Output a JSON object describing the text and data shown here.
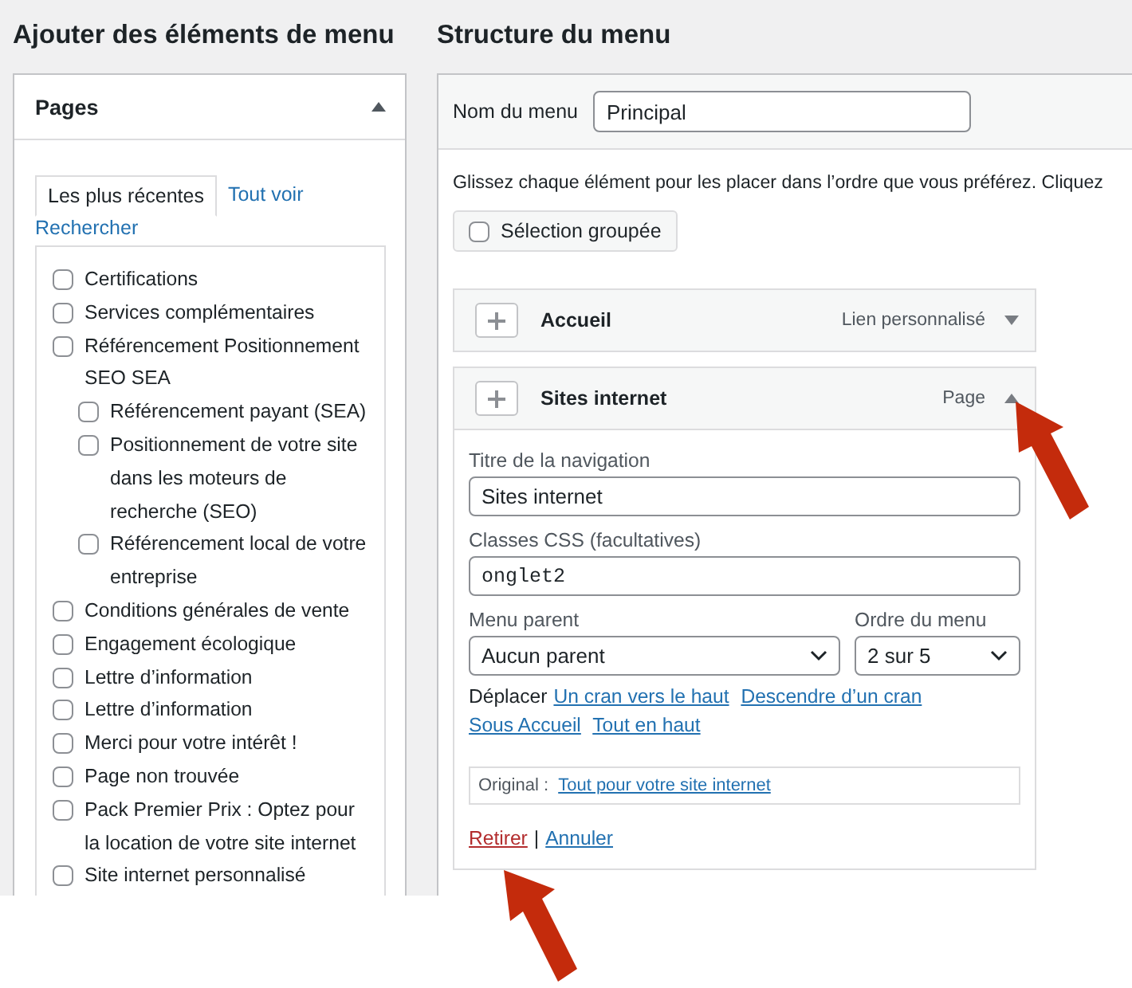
{
  "left": {
    "title": "Ajouter des éléments de menu",
    "panel": {
      "title": "Pages",
      "expanded": true,
      "tabs": [
        {
          "label": "Les plus récentes",
          "selected": true
        },
        {
          "label": "Tout voir",
          "selected": false
        },
        {
          "label": "Rechercher",
          "selected": false
        }
      ],
      "pages": [
        {
          "label": "Certifications",
          "checked": false
        },
        {
          "label": "Services complémentaires",
          "checked": false
        },
        {
          "label": "Référencement Positionnement SEO SEA",
          "checked": false,
          "children": [
            {
              "label": "Référencement payant (SEA)",
              "checked": false
            },
            {
              "label": "Positionnement de votre site dans les moteurs de recherche (SEO)",
              "checked": false
            },
            {
              "label": "Référencement local de votre entreprise",
              "checked": false
            }
          ]
        },
        {
          "label": "Conditions générales de vente",
          "checked": false
        },
        {
          "label": "Engagement écologique",
          "checked": false
        },
        {
          "label": "Lettre d’information",
          "checked": false
        },
        {
          "label": "Lettre d’information",
          "checked": false
        },
        {
          "label": "Merci pour votre intérêt !",
          "checked": false
        },
        {
          "label": "Page non trouvée",
          "checked": false
        },
        {
          "label": "Pack Premier Prix : Optez pour la location de votre site internet",
          "checked": false
        },
        {
          "label": "Site internet personnalisé",
          "checked": false
        }
      ]
    }
  },
  "right": {
    "title": "Structure du menu",
    "menu_name_label": "Nom du menu",
    "menu_name": "Principal",
    "instructions": "Glissez chaque élément pour les placer dans l’ordre que vous préférez. Cliquez",
    "bulk_select": {
      "label": "Sélection groupée",
      "checked": false
    },
    "menu_items": [
      {
        "title": "Accueil",
        "type": "Lien personnalisé",
        "expanded": false
      },
      {
        "title": "Sites internet",
        "type": "Page",
        "expanded": true,
        "nav_label": "Titre de la navigation",
        "nav_value": "Sites internet",
        "css_label": "Classes CSS (facultatives)",
        "css_value": "onglet2",
        "parent_label": "Menu parent",
        "parent_value": "Aucun parent",
        "order_label": "Ordre du menu",
        "order_value": "2 sur 5",
        "move_label": "Déplacer",
        "move_links": [
          "Un cran vers le haut",
          "Descendre d’un cran",
          "Sous Accueil",
          "Tout en haut"
        ],
        "original_label": "Original :",
        "original_link": "Tout pour votre site internet",
        "remove": "Retirer",
        "separator": "|",
        "cancel": "Annuler"
      }
    ]
  }
}
